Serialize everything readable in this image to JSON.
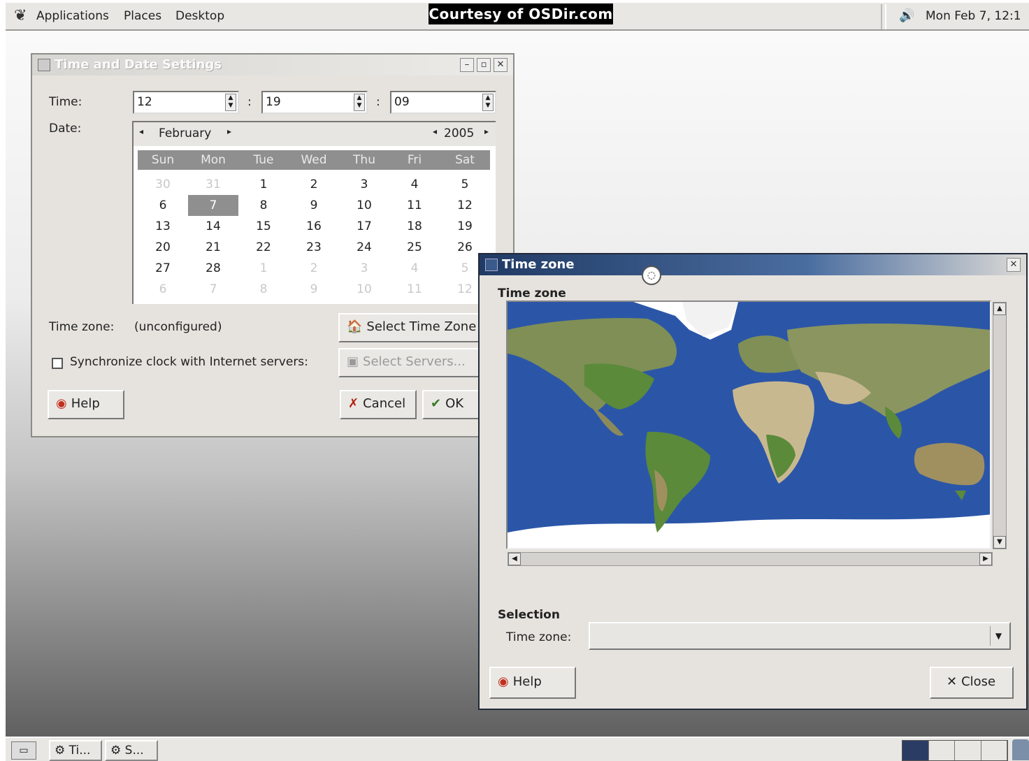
{
  "top_panel": {
    "menus": [
      "Applications",
      "Places",
      "Desktop"
    ],
    "watermark": "Courtesy of OSDir.com",
    "clock": "Mon Feb  7, 12:1"
  },
  "date_window": {
    "title": "Time and Date Settings",
    "time_label": "Time:",
    "hour": "12",
    "minute": "19",
    "second": "09",
    "separator": ":",
    "date_label": "Date:",
    "month": "February",
    "year": "2005",
    "weekdays": [
      "Sun",
      "Mon",
      "Tue",
      "Wed",
      "Thu",
      "Fri",
      "Sat"
    ],
    "days": [
      [
        "30",
        "31",
        "1",
        "2",
        "3",
        "4",
        "5"
      ],
      [
        "6",
        "7",
        "8",
        "9",
        "10",
        "11",
        "12"
      ],
      [
        "13",
        "14",
        "15",
        "16",
        "17",
        "18",
        "19"
      ],
      [
        "20",
        "21",
        "22",
        "23",
        "24",
        "25",
        "26"
      ],
      [
        "27",
        "28",
        "1",
        "2",
        "3",
        "4",
        "5"
      ],
      [
        "6",
        "7",
        "8",
        "9",
        "10",
        "11",
        "12"
      ]
    ],
    "selected_day": "7",
    "tz_label": "Time zone:",
    "tz_value": "(unconfigured)",
    "select_tz_button": "Select Time Zone",
    "sync_label": "Synchronize clock with Internet servers:",
    "sync_checked": false,
    "select_servers_button": "Select Servers...",
    "help_button": "Help",
    "cancel_button": "Cancel",
    "ok_button": "OK"
  },
  "tz_window": {
    "title": "Time zone",
    "heading": "Time zone",
    "selection_heading": "Selection",
    "tz_label": "Time zone:",
    "tz_value": "",
    "help_button": "Help",
    "close_button": "Close"
  },
  "taskbar": {
    "tasks": [
      "Ti...",
      "S..."
    ]
  }
}
